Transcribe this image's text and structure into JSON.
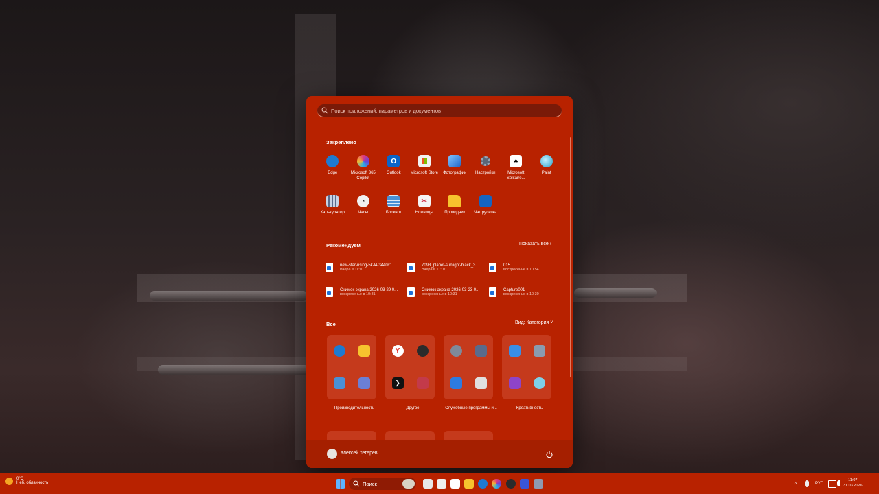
{
  "search": {
    "placeholder": "Поиск приложений, параметров и документов"
  },
  "pinned": {
    "title": "Закреплено",
    "items": [
      {
        "label": "Edge",
        "icon": "edge-icon",
        "color": "#1e7ad1"
      },
      {
        "label": "Microsoft 365 Copilot",
        "icon": "copilot-icon",
        "color": "#6b3fd6"
      },
      {
        "label": "Outlook",
        "icon": "outlook-icon",
        "color": "#0a64c9"
      },
      {
        "label": "Microsoft Store",
        "icon": "store-icon",
        "color": "#f2f2f2"
      },
      {
        "label": "Фотографии",
        "icon": "photos-icon",
        "color": "#3a8ee6"
      },
      {
        "label": "Настройки",
        "icon": "settings-icon",
        "color": "#7f8a99"
      },
      {
        "label": "Microsoft Solitaire...",
        "icon": "solitaire-icon",
        "color": "#ffffff"
      },
      {
        "label": "Paint",
        "icon": "paint-icon",
        "color": "#7fd0e8"
      },
      {
        "label": "Калькулятор",
        "icon": "calculator-icon",
        "color": "#5a6b8c"
      },
      {
        "label": "Часы",
        "icon": "clock-icon",
        "color": "#e8e8e8"
      },
      {
        "label": "Блокнот",
        "icon": "notepad-icon",
        "color": "#4a90d6"
      },
      {
        "label": "Ножницы",
        "icon": "snipping-icon",
        "color": "#f5f5f5"
      },
      {
        "label": "Проводник",
        "icon": "folder-icon",
        "color": "#f7c32e"
      },
      {
        "label": "Чат рулетка",
        "icon": "chat-roulette-icon",
        "color": "#1664c0"
      }
    ]
  },
  "recommended": {
    "title": "Рекомендуем",
    "more_label": "Показать все ›",
    "items": [
      {
        "name": "new-star-rising-5k-l4-3440x1...",
        "time": "Вчера в 11:07"
      },
      {
        "name": "7093_planet-sunlight-black_3...",
        "time": "Вчера в 11:07"
      },
      {
        "name": "015",
        "time": "воскресенье в 10:54"
      },
      {
        "name": "Снимок экрана 2026-03-29 0...",
        "time": "воскресенье в 10:31"
      },
      {
        "name": "Снимок экрана 2026-03-23 0...",
        "time": "воскресенье в 10:31"
      },
      {
        "name": "Capture001",
        "time": "воскресенье в 10:30"
      }
    ]
  },
  "all": {
    "title": "Все",
    "view_label": "Вид: Категория ˅",
    "categories": [
      {
        "label": "Производительность",
        "icons": [
          "#1e7ad1",
          "#f7c32e",
          "#4a90d6",
          "#6b7fd6"
        ]
      },
      {
        "label": "Другое",
        "icons": [
          "#ffffff",
          "#2b2b2b",
          "#111111",
          "#c33a4a"
        ]
      },
      {
        "label": "Служебные программы и...",
        "icons": [
          "#7f8a99",
          "#5a6b8c",
          "#2d7be0",
          "#e0e0e0"
        ]
      },
      {
        "label": "Креативность",
        "icons": [
          "#3a8ee6",
          "#8a9bb0",
          "#8e44c9",
          "#7fd0e8"
        ]
      }
    ]
  },
  "user": {
    "name": "алексей тетерев"
  },
  "taskbar": {
    "search_label": "Поиск",
    "weather_temp": "0°C",
    "weather_desc": "Неб. облачность",
    "lang": "РУС",
    "time": "11:07",
    "date": "31.03.2026",
    "accent": "#b82200"
  }
}
